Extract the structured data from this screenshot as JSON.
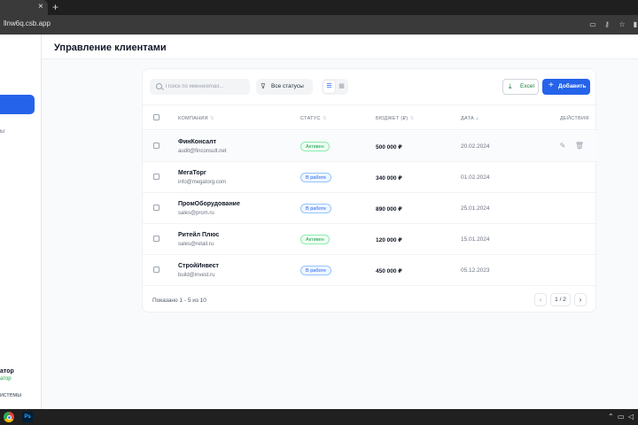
{
  "browser": {
    "tab_close": "×",
    "new_tab": "+",
    "url": "llnw6q.csb.app"
  },
  "sidebar": {
    "partial_item": "ы",
    "user_partial": "атор",
    "role_partial": "атор",
    "settings_partial": "истемы"
  },
  "header": {
    "title": "Управление клиентами"
  },
  "toolbar": {
    "search_placeholder": "Поиск по имени/email...",
    "status_filter": "Все статусы",
    "excel_label": "Excel",
    "add_label": "Добавить"
  },
  "table": {
    "columns": {
      "company": "КОМПАНИЯ",
      "status": "СТАТУС",
      "budget": "БЮДЖЕТ (₽)",
      "date": "ДАТА",
      "actions": "ДЕЙСТВИЯ"
    },
    "rows": [
      {
        "name": "ФинКонсалт",
        "email": "audit@finconsult.net",
        "status": "Активен",
        "status_type": "active",
        "budget": "500 000 ₽",
        "date": "20.02.2024"
      },
      {
        "name": "МегаТорг",
        "email": "info@megatorg.com",
        "status": "В работе",
        "status_type": "progress",
        "budget": "340 000 ₽",
        "date": "01.02.2024"
      },
      {
        "name": "ПромОборудование",
        "email": "sales@prom.ru",
        "status": "В работе",
        "status_type": "progress",
        "budget": "890 000 ₽",
        "date": "25.01.2024"
      },
      {
        "name": "Ритейл Плюс",
        "email": "sales@retail.ru",
        "status": "Активен",
        "status_type": "active",
        "budget": "120 000 ₽",
        "date": "15.01.2024"
      },
      {
        "name": "СтройИнвест",
        "email": "build@invest.ru",
        "status": "В работе",
        "status_type": "progress",
        "budget": "450 000 ₽",
        "date": "05.12.2023"
      }
    ]
  },
  "pagination": {
    "info": "Показано 1 - 5 из 10",
    "current": "1 / 2",
    "prev": "‹",
    "next": "›"
  },
  "colors": {
    "accent": "#2563eb",
    "active_text": "#16a34a",
    "active_bg": "#f0fdf4",
    "active_border": "#86efac",
    "progress_text": "#2563eb",
    "progress_bg": "#eff6ff",
    "progress_border": "#93c5fd"
  },
  "icons": {
    "filter": "filter-icon",
    "list": "list-view-icon",
    "grid": "grid-view-icon",
    "excel": "download-icon",
    "add": "plus-icon",
    "edit": "pencil-icon",
    "delete": "trash-icon",
    "sort": "sort-icon",
    "sort_desc": "arrow-down-icon"
  }
}
